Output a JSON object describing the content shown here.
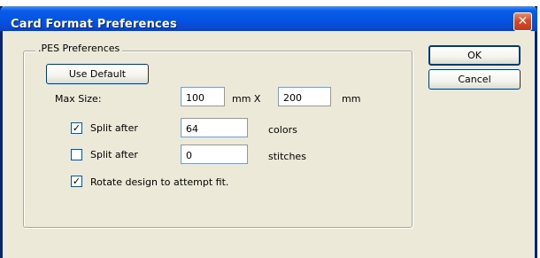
{
  "window": {
    "title": "Card Format Preferences",
    "close_glyph": "✕"
  },
  "group": {
    "label": ".PES Preferences",
    "use_default_label": "Use Default",
    "max_size_label": "Max Size:",
    "max_width": "100",
    "unit1": "mm X",
    "max_height": "200",
    "unit2": "mm",
    "split_colors": {
      "checked": true,
      "label": "Split after",
      "value": "64",
      "suffix": "colors"
    },
    "split_stitches": {
      "checked": false,
      "label": "Split after",
      "value": "0",
      "suffix": "stitches"
    },
    "rotate": {
      "checked": true,
      "label": "Rotate design to attempt fit."
    }
  },
  "buttons": {
    "ok_label": "OK",
    "cancel_label": "Cancel"
  },
  "check_glyph": "✓"
}
